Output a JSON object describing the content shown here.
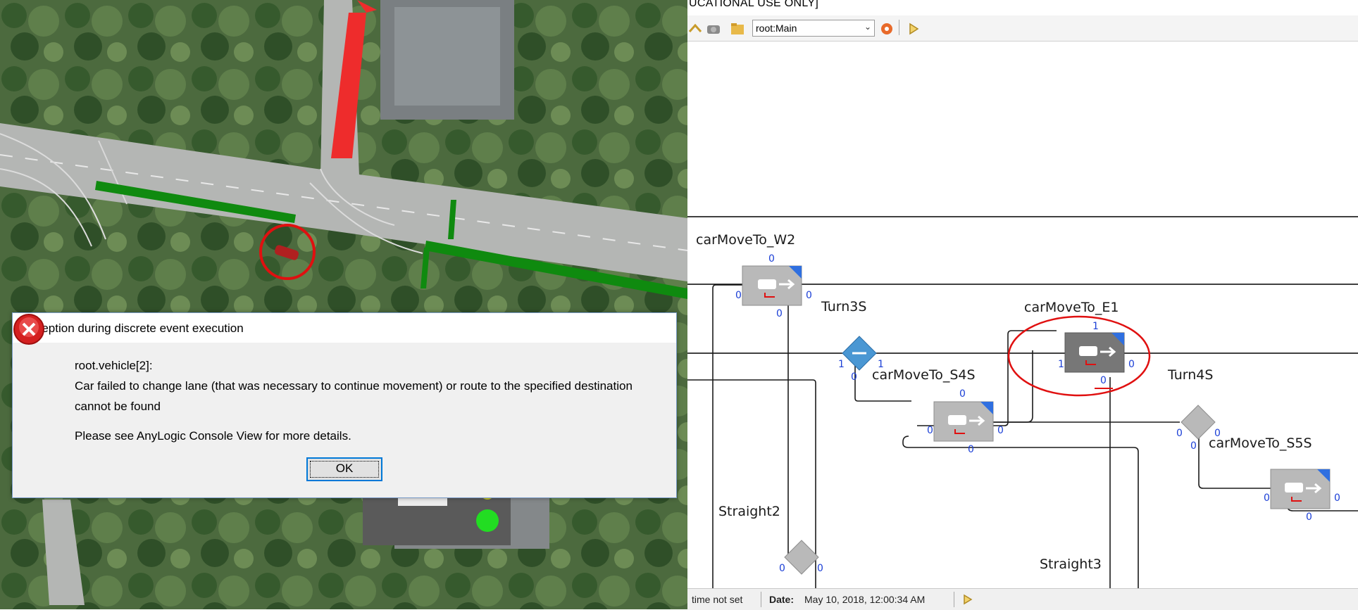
{
  "dialog": {
    "title": "Exception during discrete event execution",
    "line1": "root.vehicle[2]:",
    "line2": "Car failed to change lane (that was necessary to continue movement) or route to the specified destination",
    "line3": "cannot be found",
    "line4": "Please see AnyLogic Console View for more details.",
    "ok_label": "OK"
  },
  "banner": "UCATIONAL USE ONLY]",
  "toolbar": {
    "agent_select_value": "root:Main"
  },
  "status": {
    "time": "time not set",
    "date_label": "Date:",
    "date_value": "May 10, 2018, 12:00:34 AM"
  },
  "blocks": {
    "carMoveTo_W2": {
      "label": "carMoveTo_W2",
      "top": "0",
      "left": "0",
      "right": "0",
      "bottom": "0"
    },
    "carMoveTo_E1": {
      "label": "carMoveTo_E1",
      "top": "1",
      "left": "1",
      "right": "0",
      "bottom": "0"
    },
    "carMoveTo_S4S": {
      "label": "carMoveTo_S4S",
      "top": "0",
      "left": "0",
      "right": "0",
      "bottom": "0"
    },
    "carMoveTo_S5S": {
      "label": "carMoveTo_S5S",
      "left": "0",
      "right": "0",
      "bottom": "0"
    }
  },
  "selects": {
    "Turn3S": {
      "label": "Turn3S",
      "left": "1",
      "right": "1",
      "bottom": "0"
    },
    "Turn4S": {
      "label": "Turn4S",
      "left": "0",
      "right": "0",
      "bottom": "0"
    },
    "Straight2": {
      "label": "Straight2",
      "left": "0",
      "right": "0"
    },
    "Straight3": {
      "label": "Straight3"
    }
  },
  "colors": {
    "highlight_red": "#e01010",
    "link_green": "#128212",
    "port_blue": "#1b3fd6",
    "block_gray": "#b9b9b9",
    "block_active": "#777777",
    "select_active": "#4a97d3"
  }
}
